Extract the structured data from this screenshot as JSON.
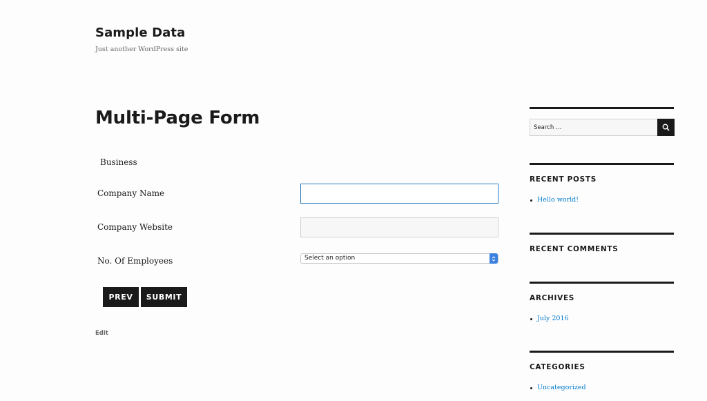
{
  "site": {
    "title": "Sample Data",
    "tagline": "Just another WordPress site"
  },
  "page": {
    "title": "Multi-Page Form",
    "edit_label": "Edit"
  },
  "form": {
    "section_label": "Business",
    "fields": [
      {
        "label": "Company Name",
        "value": "",
        "state": "focused"
      },
      {
        "label": "Company Website",
        "value": ""
      },
      {
        "label": "No. Of Employees",
        "selected": "Select an option"
      }
    ],
    "buttons": {
      "prev": "PREV",
      "submit": "SUBMIT"
    }
  },
  "sidebar": {
    "search_placeholder": "Search …",
    "widgets": [
      {
        "title": "RECENT POSTS",
        "items": [
          "Hello world!"
        ]
      },
      {
        "title": "RECENT COMMENTS",
        "items": []
      },
      {
        "title": "ARCHIVES",
        "items": [
          "July 2016"
        ]
      },
      {
        "title": "CATEGORIES",
        "items": [
          "Uncategorized"
        ]
      }
    ]
  },
  "colors": {
    "text": "#1a1a1a",
    "link": "#007acc",
    "focus_border": "#2b7bc0",
    "button_bg": "#1a1a1a",
    "muted": "#686868"
  },
  "icons": {
    "search": "magnifier-icon",
    "select_arrows": "up-down-chevron-icon"
  }
}
